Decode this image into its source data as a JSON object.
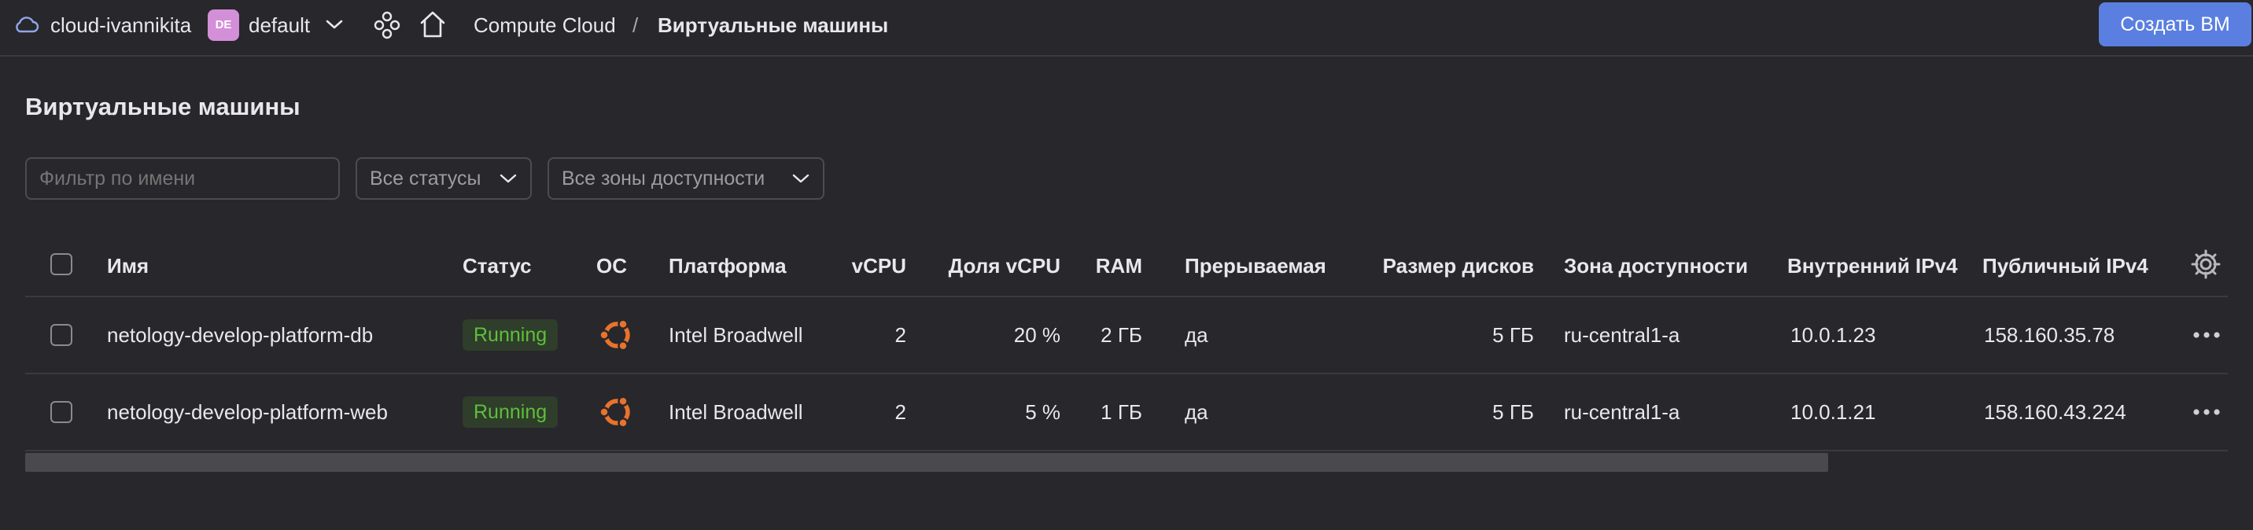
{
  "header": {
    "cloud_name": "cloud-ivannikita",
    "folder_avatar": "DE",
    "folder_name": "default",
    "breadcrumb_service": "Compute Cloud",
    "breadcrumb_separator": "/",
    "breadcrumb_current": "Виртуальные машины",
    "create_button": "Создать ВМ",
    "icons": [
      "cloud-icon",
      "chevron-down-icon",
      "services-icon",
      "home-icon"
    ]
  },
  "page": {
    "title": "Виртуальные машины"
  },
  "filters": {
    "name_placeholder": "Фильтр по имени",
    "status_value": "Все статусы",
    "zone_value": "Все зоны доступности"
  },
  "table": {
    "columns": {
      "name": "Имя",
      "status": "Статус",
      "os": "ОС",
      "platform": "Платформа",
      "vcpu": "vCPU",
      "vcpu_share": "Доля vCPU",
      "ram": "RAM",
      "preemptible": "Прерываемая",
      "disk_size": "Размер дисков",
      "zone": "Зона доступности",
      "internal_ip": "Внутренний IPv4",
      "public_ip": "Публичный IPv4"
    },
    "rows": [
      {
        "name": "netology-develop-platform-db",
        "status": "Running",
        "os_icon": "ubuntu-icon",
        "platform": "Intel Broadwell",
        "vcpu": "2",
        "vcpu_share": "20 %",
        "ram": "2 ГБ",
        "preemptible": "да",
        "disk_size": "5 ГБ",
        "zone": "ru-central1-a",
        "internal_ip": "10.0.1.23",
        "public_ip": "158.160.35.78"
      },
      {
        "name": "netology-develop-platform-web",
        "status": "Running",
        "os_icon": "ubuntu-icon",
        "platform": "Intel Broadwell",
        "vcpu": "2",
        "vcpu_share": "5 %",
        "ram": "1 ГБ",
        "preemptible": "да",
        "disk_size": "5 ГБ",
        "zone": "ru-central1-a",
        "internal_ip": "10.0.1.21",
        "public_ip": "158.160.43.224"
      }
    ]
  },
  "colors": {
    "background": "#28272c",
    "accent": "#5a7fe0",
    "status_running": "#5fbf3a",
    "ubuntu": "#e8732c",
    "avatar": "#d38fd8"
  }
}
